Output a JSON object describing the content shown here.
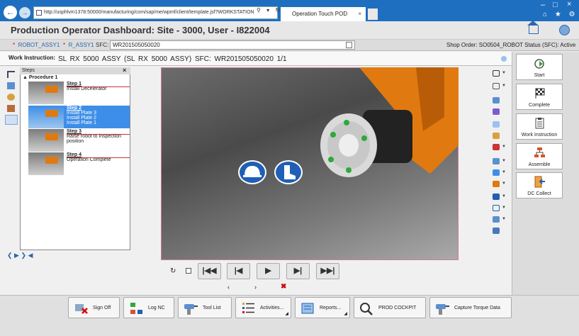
{
  "browser": {
    "url": "http://usphlvm1378:50000/manufacturing/com/sap/me/wpmf/client/template.jsf?WORKSTATION",
    "tab_title": "Operation Touch POD",
    "tab_close": "×",
    "addr_controls": "⚲ ▾ ↻",
    "minimize": "–",
    "restore": "□",
    "close": "×",
    "toolbar_icons": "⌂ ★ ⚙"
  },
  "header": {
    "title": "Production Operator Dashboard: Site - 3000, User - I822004"
  },
  "sfc_bar": {
    "star": "*",
    "field1": "ROBOT_ASSY1",
    "field2": "R_ASSY1",
    "sfc_label": "SFC:",
    "sfc_value": "WR201505050020",
    "shop_order": "Shop Order:  SO0504_ROBOT   Status (SFC):  Active"
  },
  "work_instruction": {
    "label": "Work Instruction:",
    "text": "SL RX 5000 ASSY (SL RX 5000 ASSY) SFC: WR201505050020 1/1"
  },
  "steps_panel": {
    "header": "Steps",
    "close": "×",
    "procedure": "Procedure 1",
    "nav": "❮   ▶   ❯   ◀",
    "steps": [
      {
        "title": "Step 1",
        "desc": "Install Decelerator"
      },
      {
        "title": "Step 2",
        "desc": "Install Plate 3\nInstall Plate 2\nInstall Plate 1"
      },
      {
        "title": "Step 3",
        "desc": "Raise robot to inspection position"
      },
      {
        "title": "Step 4",
        "desc": "Operation Complete"
      }
    ]
  },
  "right_panel": {
    "buttons": [
      {
        "label": "Start",
        "icon": "start-icon"
      },
      {
        "label": "Complete",
        "icon": "checkered-flag-icon"
      },
      {
        "label": "Work Instruction",
        "icon": "clipboard-icon"
      },
      {
        "label": "Assemble",
        "icon": "hierarchy-icon"
      },
      {
        "label": "DC Collect",
        "icon": "data-collect-icon"
      }
    ]
  },
  "media_controls": {
    "refresh": "↻",
    "first": "|◀◀",
    "prev": "|◀",
    "play": "▶",
    "next": "▶|",
    "last": "▶▶|",
    "small_prev": "‹",
    "small_next": "›",
    "red_x": "✖"
  },
  "bottom_bar": {
    "buttons": [
      {
        "label": "Sign Off",
        "icon": "sign-off-icon"
      },
      {
        "label": "Log NC",
        "icon": "log-nc-icon"
      },
      {
        "label": "Tool List",
        "icon": "drill-icon"
      },
      {
        "label": "Activities...",
        "icon": "list-icon"
      },
      {
        "label": "Reports...",
        "icon": "report-icon"
      },
      {
        "label": "PROD COCKPIT",
        "icon": "magnifier-icon"
      },
      {
        "label": "Capture Torque Data",
        "icon": "drill-icon"
      }
    ],
    "dropdown_marker": "◢"
  },
  "colors": {
    "titlebar": "#1e6fc0",
    "selected_step": "#3d8ee8",
    "robot_orange": "#e07a10",
    "safety_blue": "#1f5fb5"
  }
}
